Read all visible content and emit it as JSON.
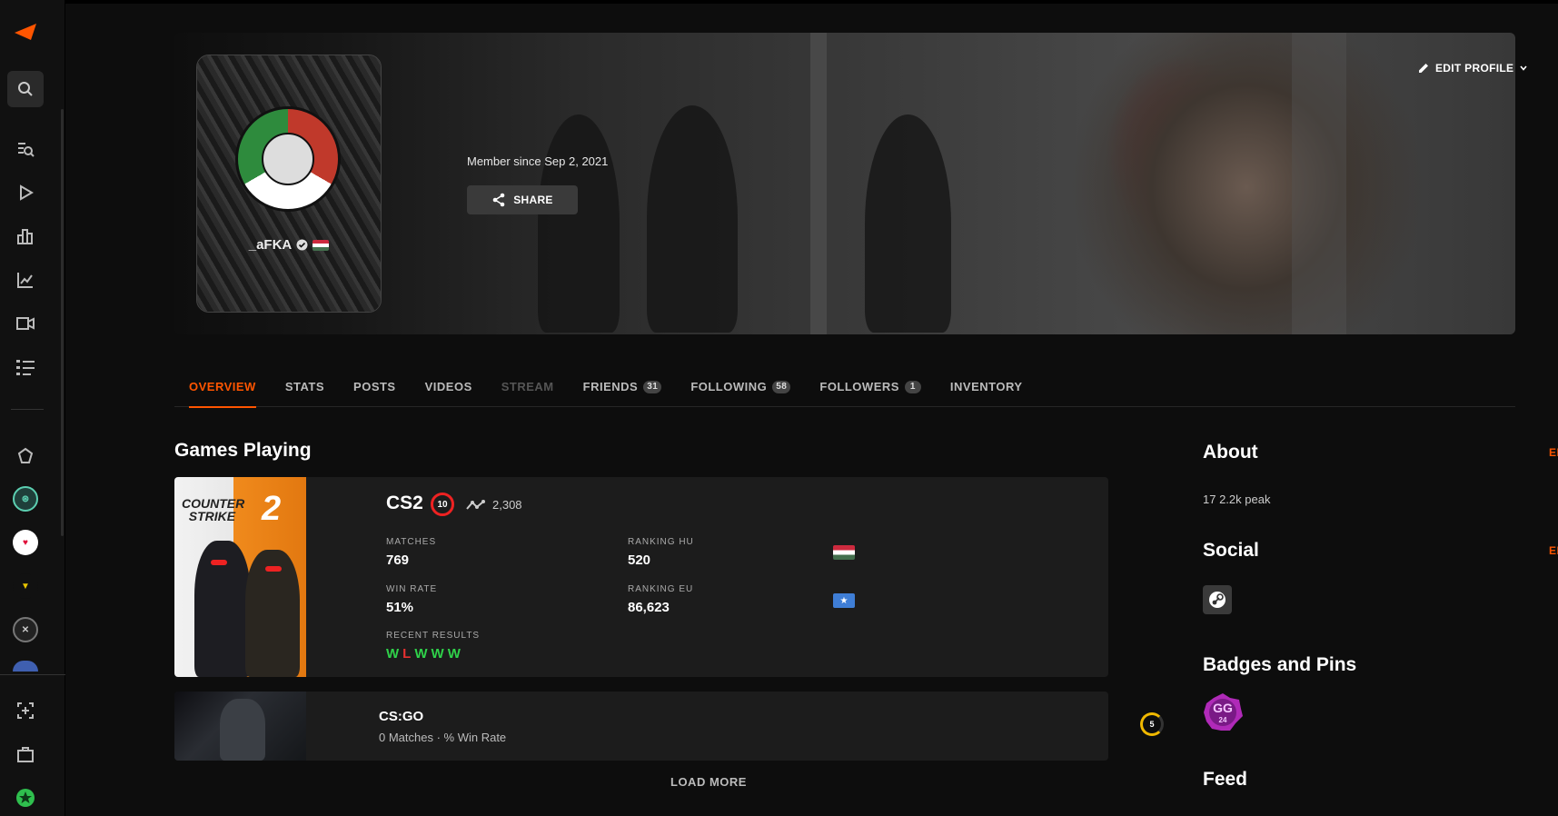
{
  "profile": {
    "username": "_aFKA",
    "member_since": "Member since Sep 2, 2021",
    "share_label": "SHARE",
    "edit_profile_label": "EDIT PROFILE"
  },
  "tabs": [
    {
      "label": "OVERVIEW",
      "active": true
    },
    {
      "label": "STATS"
    },
    {
      "label": "POSTS"
    },
    {
      "label": "VIDEOS"
    },
    {
      "label": "STREAM",
      "disabled": true
    },
    {
      "label": "FRIENDS",
      "count": "31"
    },
    {
      "label": "FOLLOWING",
      "count": "58"
    },
    {
      "label": "FOLLOWERS",
      "count": "1"
    },
    {
      "label": "INVENTORY"
    }
  ],
  "games_section": {
    "title": "Games Playing",
    "load_more": "LOAD MORE"
  },
  "cs2": {
    "art_text_line1": "COUNTER",
    "art_text_line2": "STRIKE",
    "art_number": "2",
    "title": "CS2",
    "level": "10",
    "elo": "2,308",
    "matches_label": "MATCHES",
    "matches": "769",
    "winrate_label": "WIN RATE",
    "winrate": "51%",
    "rank_hu_label": "RANKING HU",
    "rank_hu": "520",
    "rank_eu_label": "RANKING EU",
    "rank_eu": "86,623",
    "recent_label": "RECENT RESULTS",
    "recent": [
      "W",
      "L",
      "W",
      "W",
      "W"
    ]
  },
  "csgo": {
    "title": "CS:GO",
    "subtitle": "0 Matches · % Win Rate",
    "level": "5"
  },
  "sidebar_right": {
    "about_title": "About",
    "about_text": "17 2.2k peak",
    "social_title": "Social",
    "badges_title": "Badges and Pins",
    "badge_text": "GG",
    "badge_subtext": "24",
    "feed_title": "Feed",
    "edit_label": "EDIT"
  },
  "colors": {
    "accent": "#ff5500",
    "win": "#2fd24a",
    "loss": "#e63030"
  }
}
